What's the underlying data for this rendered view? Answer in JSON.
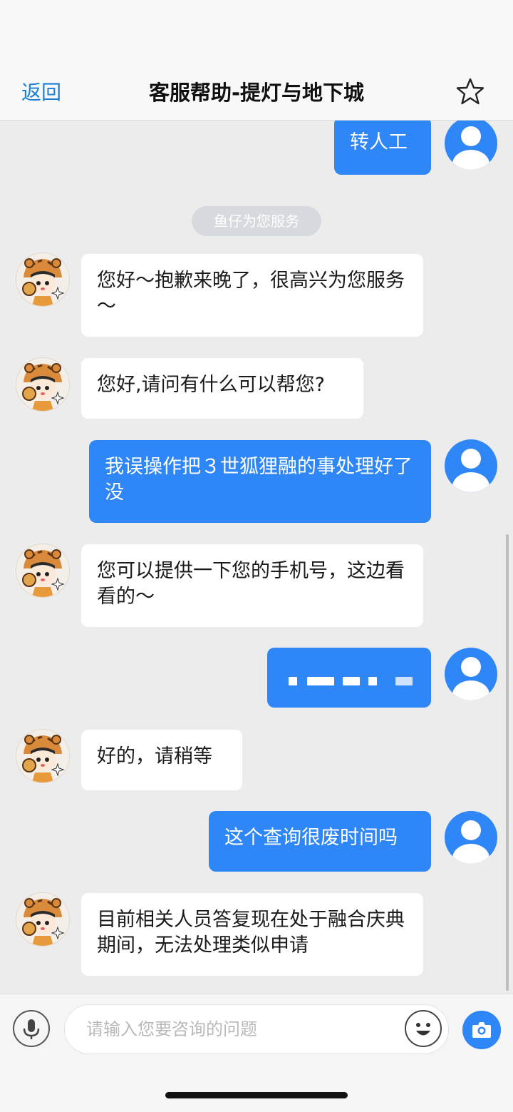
{
  "header": {
    "back_label": "返回",
    "title": "客服帮助-提灯与地下城",
    "favorite_icon": "star-outline-icon"
  },
  "chat": {
    "system_notice": "鱼仔为您服务",
    "messages": [
      {
        "from": "user",
        "text": "转人工"
      },
      {
        "from": "agent",
        "text": "您好～抱歉来晚了，很高兴为您服务～"
      },
      {
        "from": "agent",
        "text": "您好,请问有什么可以帮您?"
      },
      {
        "from": "user",
        "text": "我误操作把３世狐狸融的事处理好了没"
      },
      {
        "from": "agent",
        "text": "您可以提供一下您的手机号，这边看看的～"
      },
      {
        "from": "user",
        "text": "",
        "redacted": true
      },
      {
        "from": "agent",
        "text": "好的，请稍等"
      },
      {
        "from": "user",
        "text": "这个查询很废时间吗"
      },
      {
        "from": "agent",
        "text": "目前相关人员答复现在处于融合庆典期间，无法处理类似申请"
      }
    ]
  },
  "input": {
    "placeholder": "请输入您要咨询的问题",
    "voice_icon": "microphone-icon",
    "emoji_icon": "emoji-icon",
    "camera_icon": "camera-icon"
  },
  "colors": {
    "accent": "#2f86f6",
    "link": "#1c7ed6",
    "chat_background": "#ececec"
  }
}
